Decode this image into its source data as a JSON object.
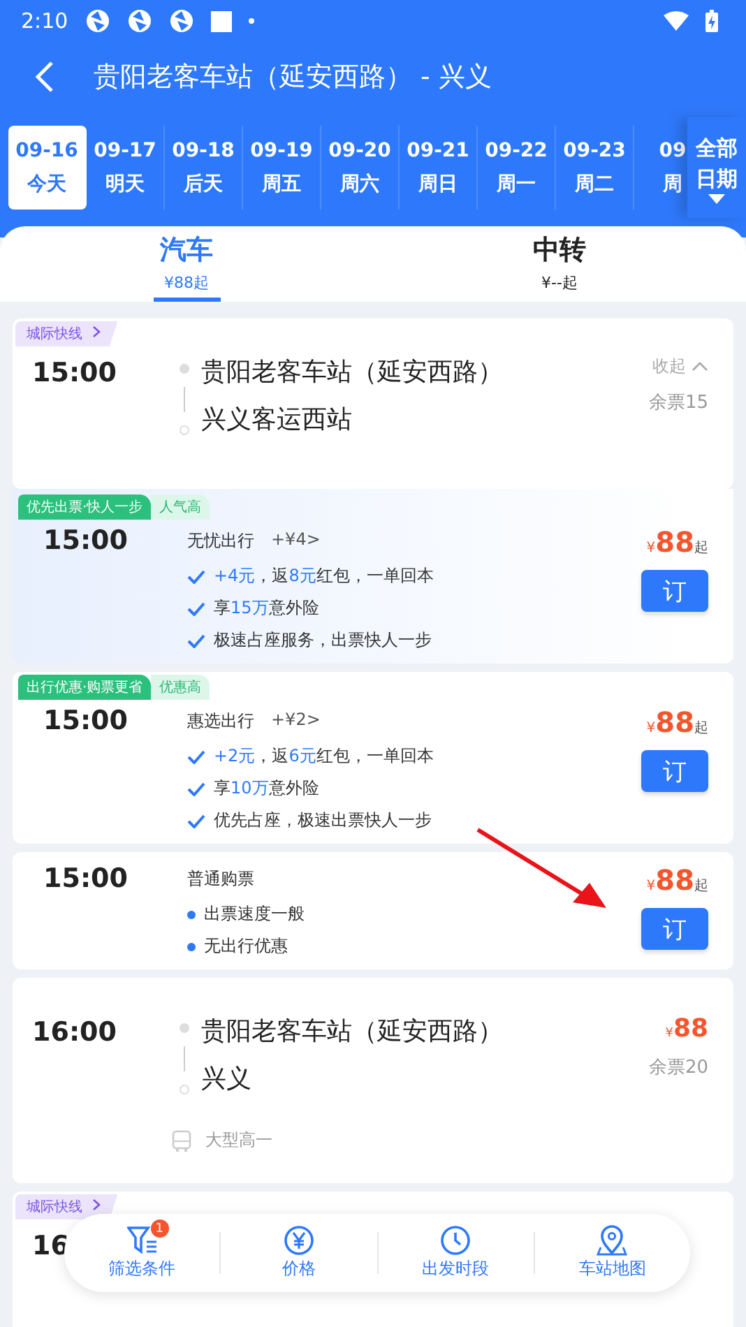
{
  "status_bar": {
    "time": "2:10"
  },
  "header": {
    "title": "贵阳老客车站（延安西路） - 兴义"
  },
  "dates": [
    {
      "date": "09-16",
      "day": "今天",
      "selected": true
    },
    {
      "date": "09-17",
      "day": "明天",
      "selected": false
    },
    {
      "date": "09-18",
      "day": "后天",
      "selected": false
    },
    {
      "date": "09-19",
      "day": "周五",
      "selected": false
    },
    {
      "date": "09-20",
      "day": "周六",
      "selected": false
    },
    {
      "date": "09-21",
      "day": "周日",
      "selected": false
    },
    {
      "date": "09-22",
      "day": "周一",
      "selected": false
    },
    {
      "date": "09-23",
      "day": "周二",
      "selected": false
    },
    {
      "date": "09",
      "day": "周",
      "selected": false
    }
  ],
  "all_dates": "全部日期",
  "mode_tabs": [
    {
      "label": "汽车",
      "price": "¥88起",
      "selected": true
    },
    {
      "label": "中转",
      "price": "¥--起",
      "selected": false
    }
  ],
  "trips": [
    {
      "kind": "route",
      "tag": "城际快线",
      "time": "15:00",
      "from": "贵阳老客车站（延安西路）",
      "to": "兴义客运西站",
      "toggle": "收起",
      "seats": "余票15"
    },
    {
      "kind": "option",
      "tags": [
        "优先出票·快人一步",
        "人气高"
      ],
      "time": "15:00",
      "title": "无忧出行",
      "extra": "+¥4>",
      "features": [
        {
          "kind": "check",
          "text": "**+4元**，返**8元**红包，一单回本"
        },
        {
          "kind": "check",
          "text": "享**15万**意外险"
        },
        {
          "kind": "check",
          "text": "极速占座服务，出票快人一步"
        }
      ],
      "currency": "¥",
      "amount": "88",
      "suffix": "起",
      "button": "订",
      "joined": true
    },
    {
      "kind": "option",
      "tags": [
        "出行优惠·购票更省",
        "优惠高"
      ],
      "time": "15:00",
      "title": "惠选出行",
      "extra": "+¥2>",
      "features": [
        {
          "kind": "check",
          "text": "**+2元**，返**6元**红包，一单回本"
        },
        {
          "kind": "check",
          "text": "享**10万**意外险"
        },
        {
          "kind": "check",
          "text": "优先占座，极速出票快人一步"
        }
      ],
      "currency": "¥",
      "amount": "88",
      "suffix": "起",
      "button": "订",
      "joined": false
    },
    {
      "kind": "option",
      "time": "15:00",
      "title": "普通购票",
      "features": [
        {
          "kind": "dot",
          "text": "出票速度一般"
        },
        {
          "kind": "dot",
          "text": "无出行优惠"
        }
      ],
      "currency": "¥",
      "amount": "88",
      "suffix": "起",
      "button": "订",
      "joined": false
    },
    {
      "kind": "route",
      "time": "16:00",
      "from": "贵阳老客车站（延安西路）",
      "to": "兴义",
      "currency": "¥",
      "amount": "88",
      "seats": "余票20",
      "bus": "大型高一"
    },
    {
      "kind": "route",
      "tag": "城际快线",
      "time": "16"
    }
  ],
  "filter_bar": [
    {
      "kind": "filter",
      "label": "筛选条件",
      "badge": "1"
    },
    {
      "kind": "price",
      "label": "价格"
    },
    {
      "kind": "clock",
      "label": "出发时段"
    },
    {
      "kind": "pin",
      "label": "车站地图"
    }
  ]
}
